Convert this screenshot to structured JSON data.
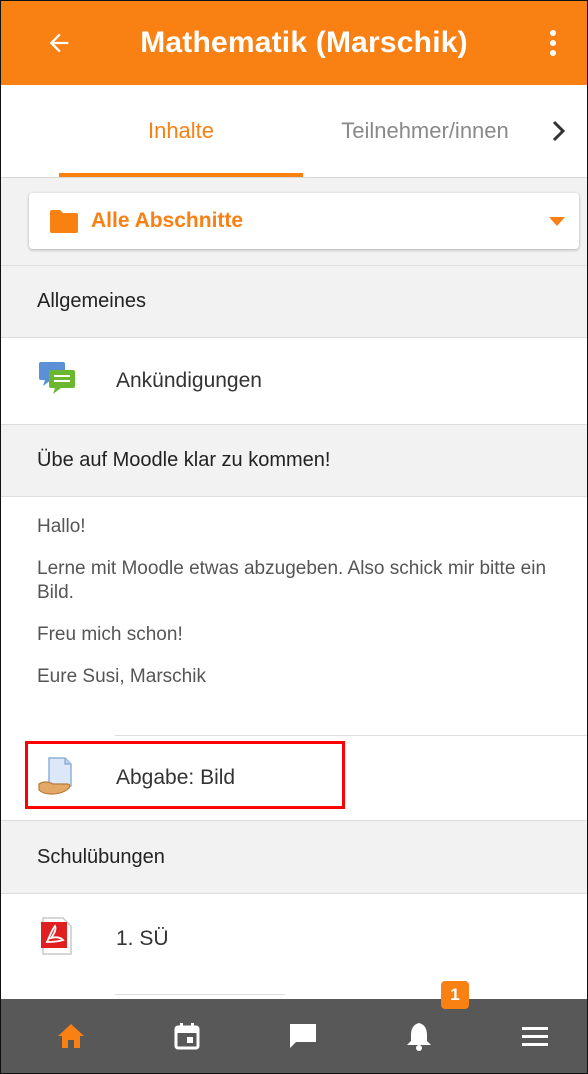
{
  "header": {
    "title": "Mathematik (Marschik)"
  },
  "tabs": [
    {
      "label": "Inhalte",
      "active": true
    },
    {
      "label": "Teilnehmer/innen",
      "active": false
    }
  ],
  "section_selector": {
    "label": "Alle Abschnitte"
  },
  "sections": [
    {
      "title": "Allgemeines",
      "items": [
        {
          "label": "Ankündigungen",
          "icon": "forum-icon"
        }
      ]
    },
    {
      "title": "Übe auf Moodle klar zu kommen!",
      "summary": [
        "Hallo!",
        "Lerne mit Moodle etwas abzugeben. Also schick mir bitte ein Bild.",
        "Freu mich schon!",
        "Eure Susi, Marschik"
      ],
      "items": [
        {
          "label": "Abgabe: Bild",
          "icon": "assignment-icon",
          "highlighted": true
        }
      ]
    },
    {
      "title": "Schulübungen",
      "items": [
        {
          "label": "1. SÜ",
          "icon": "pdf-icon"
        }
      ]
    }
  ],
  "bottom_nav": {
    "items": [
      "home-icon",
      "calendar-icon",
      "messages-icon",
      "notifications-icon",
      "menu-icon"
    ],
    "notification_badge": "1"
  },
  "colors": {
    "accent": "#f98012",
    "bottom_bar": "#585858",
    "highlight": "#ff0000"
  }
}
